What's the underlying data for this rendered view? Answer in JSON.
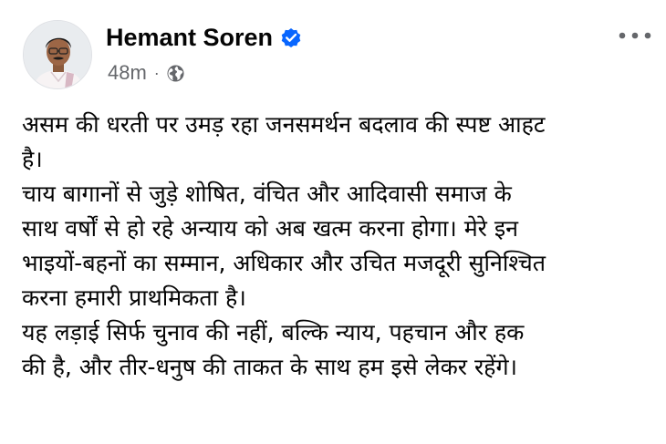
{
  "author": {
    "name": "Hemant Soren",
    "verified_icon": "verified-badge-icon",
    "timestamp": "48m",
    "separator": "·",
    "audience_icon": "globe-icon"
  },
  "actions": {
    "more_icon": "more-options-icon"
  },
  "colors": {
    "verified": "#0866ff",
    "meta_text": "#65676b",
    "text": "#050505"
  },
  "post": {
    "lines": [
      "असम की धरती पर उमड़ रहा जनसमर्थन बदलाव की स्पष्ट आहट",
      "है।",
      "चाय बागानों से जुड़े शोषित, वंचित और आदिवासी समाज के",
      "साथ वर्षों से हो रहे अन्याय को अब खत्म करना होगा। मेरे इन",
      "भाइयों-बहनों का सम्मान, अधिकार और उचित मजदूरी सुनिश्चित",
      "करना हमारी प्राथमिकता है।",
      "यह लड़ाई सिर्फ चुनाव की नहीं, बल्कि न्याय, पहचान और हक",
      "की है, और तीर-धनुष की ताकत के साथ हम इसे लेकर रहेंगे।"
    ]
  }
}
